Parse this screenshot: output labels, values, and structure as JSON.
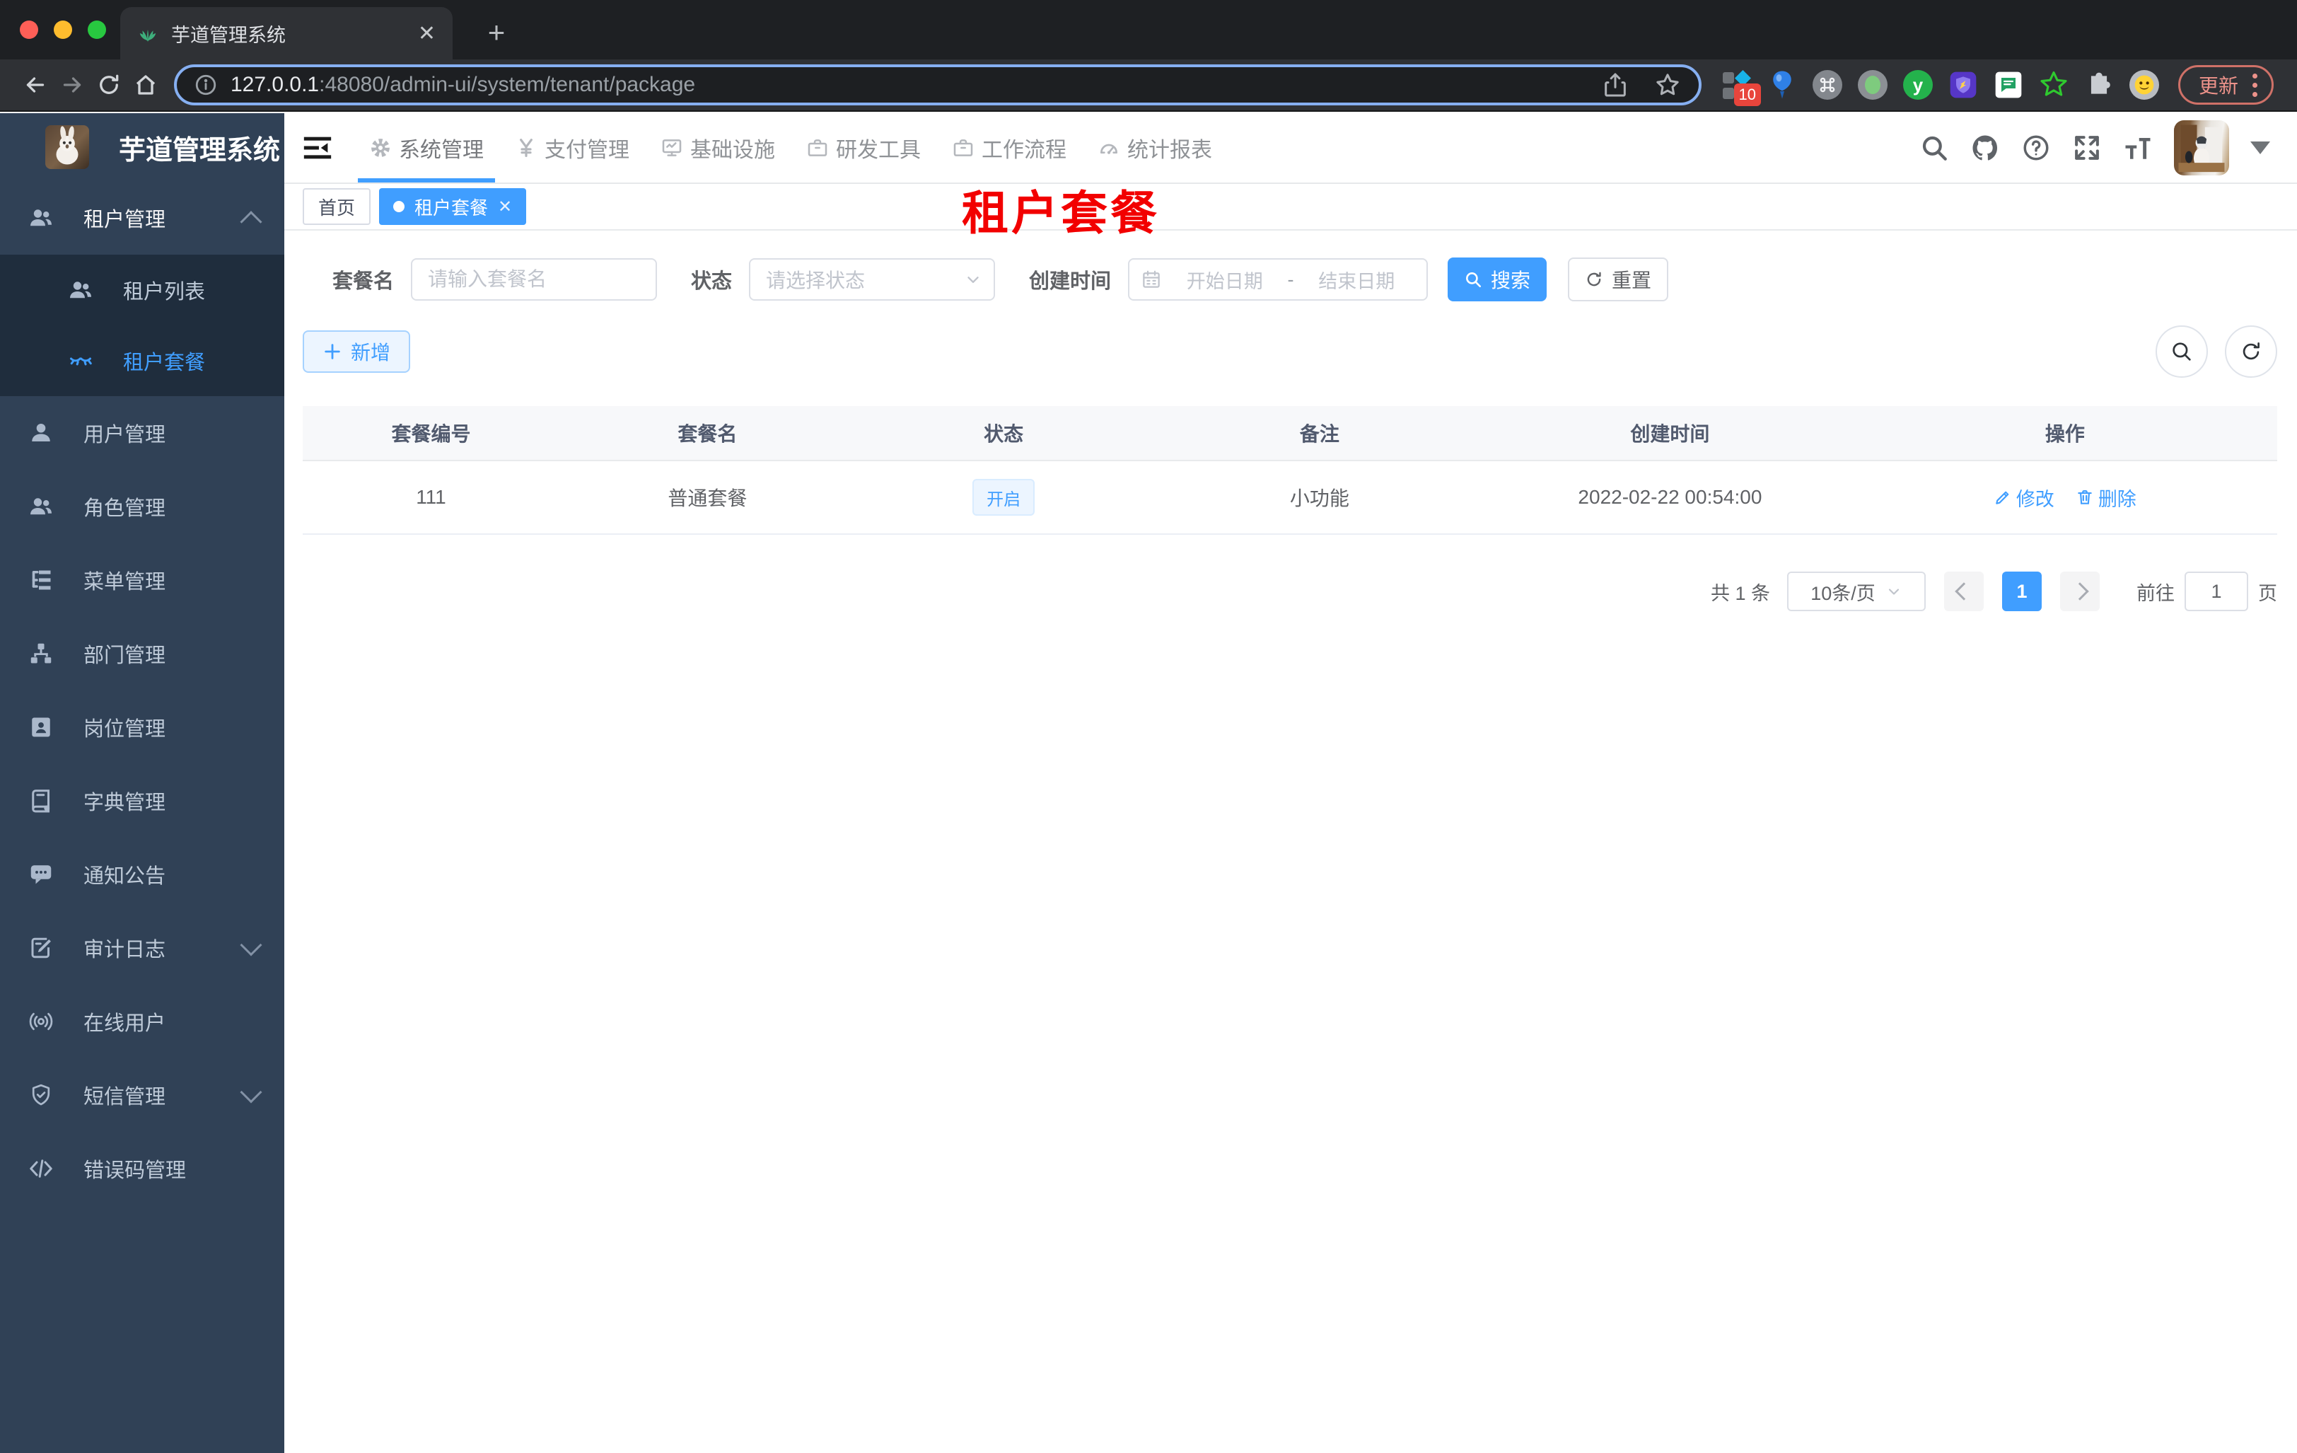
{
  "browser": {
    "tab_title": "芋道管理系统",
    "new_tab": "+",
    "close_tab": "✕",
    "url_host": "127.0.0.1",
    "url_rest": ":48080/admin-ui/system/tenant/package",
    "ext_badge": "10",
    "ext_y_label": "y",
    "update_label": "更新"
  },
  "sidebar": {
    "app_title": "芋道管理系统",
    "items": [
      {
        "label": "租户管理"
      },
      {
        "label": "租户列表"
      },
      {
        "label": "租户套餐"
      },
      {
        "label": "用户管理"
      },
      {
        "label": "角色管理"
      },
      {
        "label": "菜单管理"
      },
      {
        "label": "部门管理"
      },
      {
        "label": "岗位管理"
      },
      {
        "label": "字典管理"
      },
      {
        "label": "通知公告"
      },
      {
        "label": "审计日志"
      },
      {
        "label": "在线用户"
      },
      {
        "label": "短信管理"
      },
      {
        "label": "错误码管理"
      }
    ]
  },
  "topnav": {
    "items": [
      {
        "label": "系统管理"
      },
      {
        "label": "支付管理"
      },
      {
        "label": "基础设施"
      },
      {
        "label": "研发工具"
      },
      {
        "label": "工作流程"
      },
      {
        "label": "统计报表"
      }
    ]
  },
  "tags": {
    "home": "首页",
    "active": "租户套餐",
    "close": "✕"
  },
  "page": {
    "red_title": "租户套餐"
  },
  "filter": {
    "name_label": "套餐名",
    "name_placeholder": "请输入套餐名",
    "status_label": "状态",
    "status_placeholder": "请选择状态",
    "date_label": "创建时间",
    "date_start": "开始日期",
    "date_sep": "-",
    "date_end": "结束日期",
    "search_label": "搜索",
    "reset_label": "重置"
  },
  "toolbar": {
    "add_label": "新增"
  },
  "table": {
    "headers": [
      "套餐编号",
      "套餐名",
      "状态",
      "备注",
      "创建时间",
      "操作"
    ],
    "row": {
      "id": "111",
      "name": "普通套餐",
      "status": "开启",
      "remark": "小功能",
      "created": "2022-02-22 00:54:00",
      "edit": "修改",
      "delete": "删除"
    }
  },
  "pagination": {
    "total": "共 1 条",
    "page_size": "10条/页",
    "page": "1",
    "goto": "前往",
    "goto_value": "1",
    "unit": "页"
  },
  "colors": {
    "accent": "#409eff",
    "sidebar_bg": "#304156",
    "submenu_bg": "#1f2d3d",
    "red_title": "#f20000"
  }
}
